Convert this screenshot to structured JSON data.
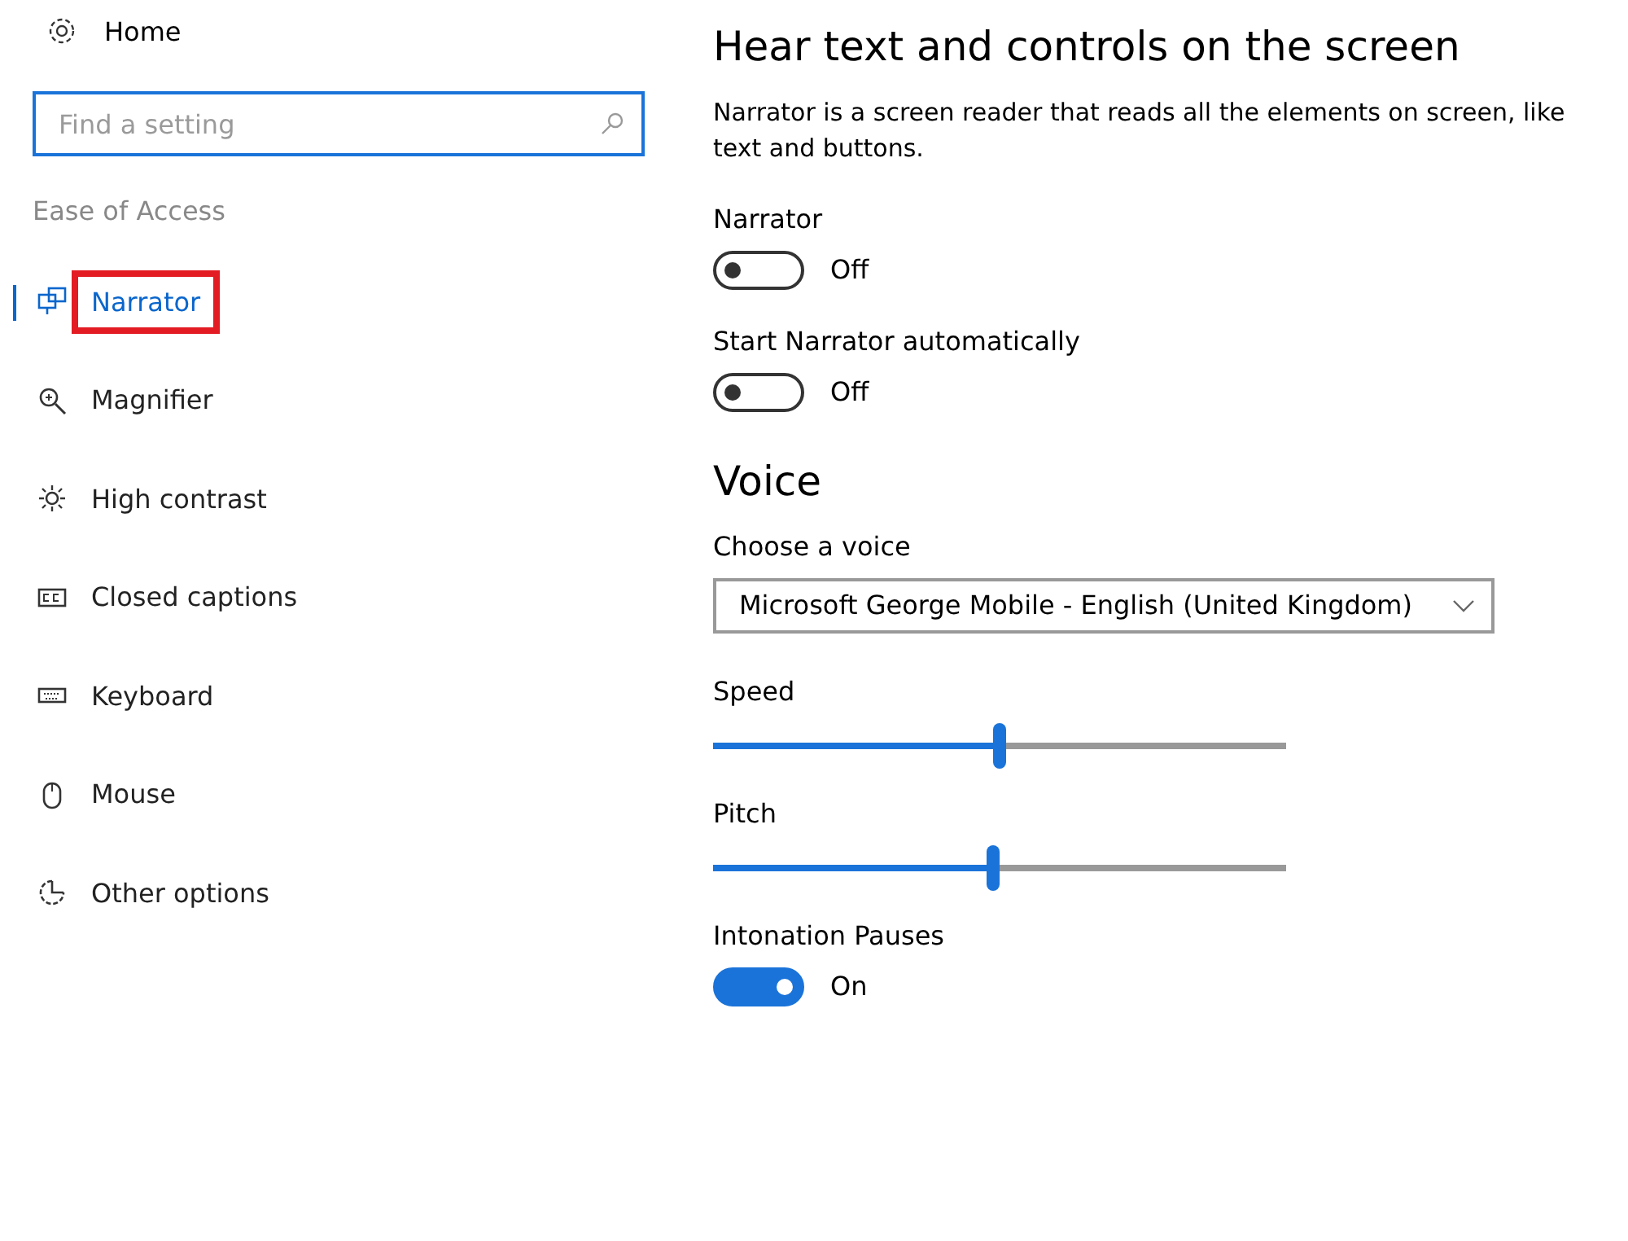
{
  "sidebar": {
    "home": "Home",
    "search": {
      "placeholder": "Find a setting"
    },
    "section": "Ease of Access",
    "items": [
      {
        "label": "Narrator",
        "selected": true,
        "highlighted": true
      },
      {
        "label": "Magnifier",
        "selected": false,
        "highlighted": false
      },
      {
        "label": "High contrast",
        "selected": false,
        "highlighted": false
      },
      {
        "label": "Closed captions",
        "selected": false,
        "highlighted": false
      },
      {
        "label": "Keyboard",
        "selected": false,
        "highlighted": false
      },
      {
        "label": "Mouse",
        "selected": false,
        "highlighted": false
      },
      {
        "label": "Other options",
        "selected": false,
        "highlighted": false
      }
    ]
  },
  "main": {
    "title": "Hear text and controls on the screen",
    "description": "Narrator is a screen reader that reads all the elements on screen, like text and buttons.",
    "settings": [
      {
        "kind": "toggle",
        "label": "Narrator",
        "on": false,
        "state_text": "Off"
      },
      {
        "kind": "toggle",
        "label": "Start Narrator automatically",
        "on": false,
        "state_text": "Off"
      },
      {
        "kind": "heading",
        "label": "Voice"
      },
      {
        "kind": "dropdown",
        "label": "Choose a voice",
        "value": "Microsoft George Mobile - English (United Kingdom)"
      },
      {
        "kind": "slider",
        "label": "Speed",
        "level": 0.5
      },
      {
        "kind": "slider",
        "label": "Pitch",
        "level": 0.49
      },
      {
        "kind": "toggle",
        "label": "Intonation Pauses",
        "on": true,
        "state_text": "On"
      }
    ]
  }
}
